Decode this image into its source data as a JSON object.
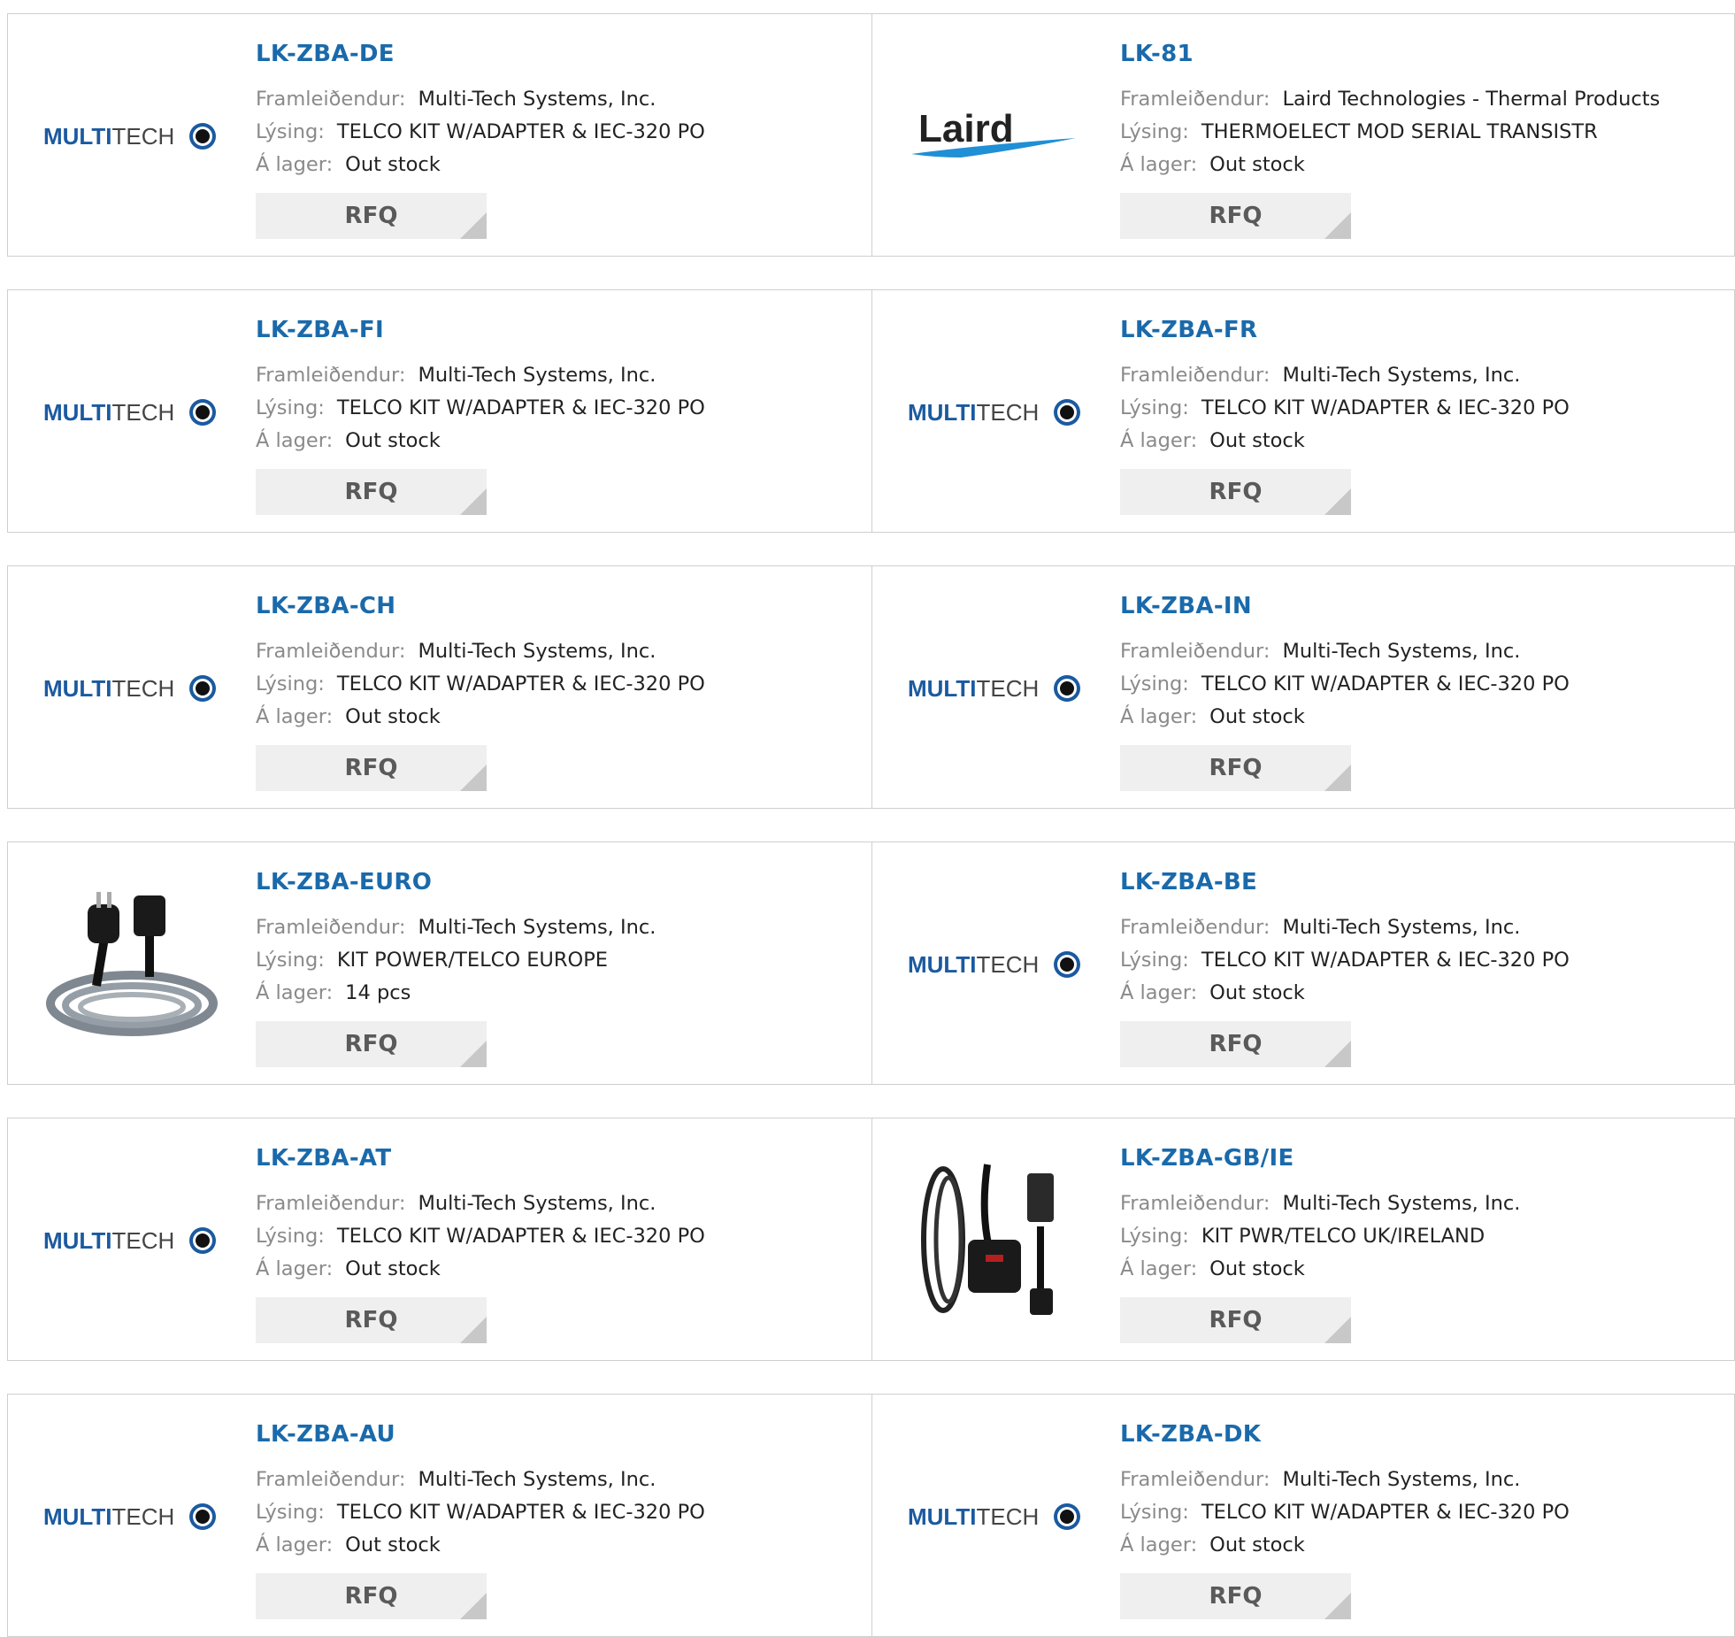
{
  "labels": {
    "manufacturer": "Framleiðendur:",
    "description": "Lýsing:",
    "stock": "Á lager:",
    "rfq": "RFQ"
  },
  "logo_text": {
    "multitech_bold": "MULTI",
    "multitech_light": "TECH",
    "laird": "Laird"
  },
  "brand_colors": {
    "link": "#1a6aab",
    "multitech_blue": "#1b5aa0",
    "laird_blue": "#1f8fd6"
  },
  "products": [
    {
      "part": "LK-ZBA-DE",
      "manufacturer": "Multi-Tech Systems, Inc.",
      "description": "TELCO KIT W/ADAPTER & IEC-320 PO",
      "stock": "Out stock",
      "image": "multitech-logo"
    },
    {
      "part": "LK-81",
      "manufacturer": "Laird Technologies - Thermal Products",
      "description": "THERMOELECT MOD SERIAL TRANSISTR",
      "stock": "Out stock",
      "image": "laird-logo"
    },
    {
      "part": "LK-ZBA-FI",
      "manufacturer": "Multi-Tech Systems, Inc.",
      "description": "TELCO KIT W/ADAPTER & IEC-320 PO",
      "stock": "Out stock",
      "image": "multitech-logo"
    },
    {
      "part": "LK-ZBA-FR",
      "manufacturer": "Multi-Tech Systems, Inc.",
      "description": "TELCO KIT W/ADAPTER & IEC-320 PO",
      "stock": "Out stock",
      "image": "multitech-logo"
    },
    {
      "part": "LK-ZBA-CH",
      "manufacturer": "Multi-Tech Systems, Inc.",
      "description": "TELCO KIT W/ADAPTER & IEC-320 PO",
      "stock": "Out stock",
      "image": "multitech-logo"
    },
    {
      "part": "LK-ZBA-IN",
      "manufacturer": "Multi-Tech Systems, Inc.",
      "description": "TELCO KIT W/ADAPTER & IEC-320 PO",
      "stock": "Out stock",
      "image": "multitech-logo"
    },
    {
      "part": "LK-ZBA-EURO",
      "manufacturer": "Multi-Tech Systems, Inc.",
      "description": "KIT POWER/TELCO EUROPE",
      "stock": "14 pcs",
      "image": "euro-cable-photo"
    },
    {
      "part": "LK-ZBA-BE",
      "manufacturer": "Multi-Tech Systems, Inc.",
      "description": "TELCO KIT W/ADAPTER & IEC-320 PO",
      "stock": "Out stock",
      "image": "multitech-logo"
    },
    {
      "part": "LK-ZBA-AT",
      "manufacturer": "Multi-Tech Systems, Inc.",
      "description": "TELCO KIT W/ADAPTER & IEC-320 PO",
      "stock": "Out stock",
      "image": "multitech-logo"
    },
    {
      "part": "LK-ZBA-GB/IE",
      "manufacturer": "Multi-Tech Systems, Inc.",
      "description": "KIT PWR/TELCO UK/IRELAND",
      "stock": "Out stock",
      "image": "uk-cable-photo"
    },
    {
      "part": "LK-ZBA-AU",
      "manufacturer": "Multi-Tech Systems, Inc.",
      "description": "TELCO KIT W/ADAPTER & IEC-320 PO",
      "stock": "Out stock",
      "image": "multitech-logo"
    },
    {
      "part": "LK-ZBA-DK",
      "manufacturer": "Multi-Tech Systems, Inc.",
      "description": "TELCO KIT W/ADAPTER & IEC-320 PO",
      "stock": "Out stock",
      "image": "multitech-logo"
    }
  ]
}
